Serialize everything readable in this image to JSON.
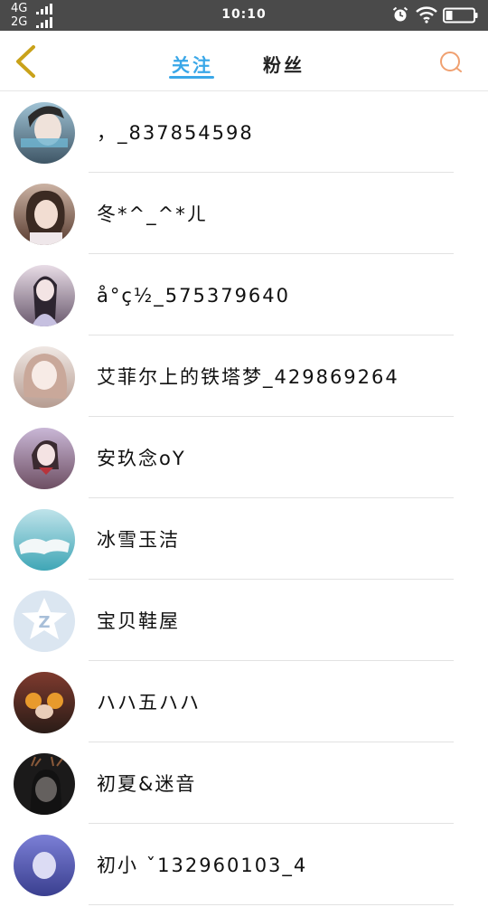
{
  "status_bar": {
    "network_top": "4G",
    "network_bottom": "2G",
    "time": "10:10"
  },
  "header": {
    "tabs": [
      {
        "label": "关注",
        "active": true
      },
      {
        "label": "粉丝",
        "active": false
      }
    ]
  },
  "colors": {
    "accent": "#3aa7e8",
    "search": "#f0a070",
    "back": "#c9a21a"
  },
  "users": [
    {
      "name": "，_837854598",
      "avatar_colors": [
        "#9fc2d4",
        "#3f5666"
      ]
    },
    {
      "name": "  冬*^_^*ㄦ",
      "avatar_colors": [
        "#cbb2a3",
        "#5a3d31"
      ]
    },
    {
      "name": "å°ç½_575379640",
      "avatar_colors": [
        "#e8dce6",
        "#6a5a6e"
      ]
    },
    {
      "name": "艾菲尔上的铁塔梦_429869264",
      "avatar_colors": [
        "#efe7e3",
        "#b69c91"
      ]
    },
    {
      "name": "安玖念oY",
      "avatar_colors": [
        "#c9b7d6",
        "#6e4f63"
      ]
    },
    {
      "name": "冰雪玉洁",
      "avatar_colors": [
        "#bfe3ea",
        "#3fa6b6"
      ]
    },
    {
      "name": "宝贝鞋屋",
      "avatar_colors": [
        "#dbe6f1",
        "#a8bfd9"
      ]
    },
    {
      "name": "ハハ五ハハ",
      "avatar_colors": [
        "#7e3a2e",
        "#2a1c17"
      ]
    },
    {
      "name": "初夏&迷音",
      "avatar_colors": [
        "#2b2a2a",
        "#0f0f0f"
      ]
    },
    {
      "name": "初小 ˇ132960103_4",
      "avatar_colors": [
        "#7b7fd6",
        "#3a3f8f"
      ]
    }
  ]
}
